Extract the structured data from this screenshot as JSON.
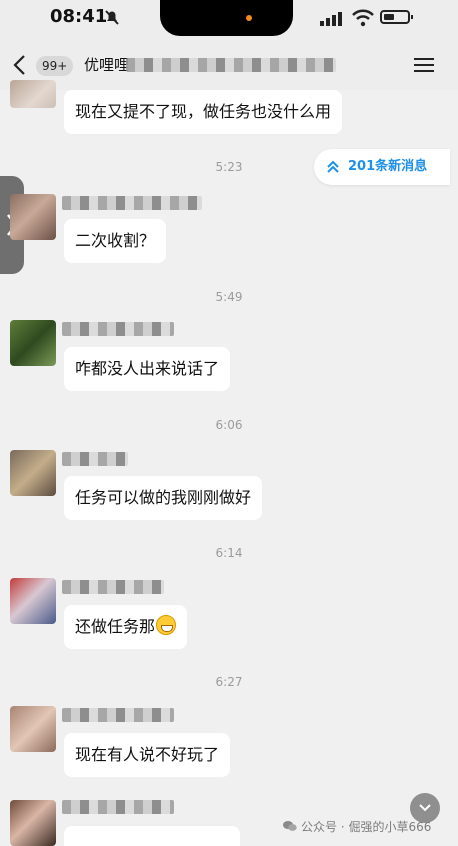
{
  "status_bar": {
    "time": "08:41",
    "icons": [
      "bell-off-icon",
      "signal-icon",
      "wifi-icon",
      "battery-icon"
    ],
    "accent": "#f28b1f"
  },
  "header": {
    "back_icon": "chevron-left-icon",
    "unread_badge": "99+",
    "title": "优哩哩",
    "menu_icon": "menu-icon"
  },
  "new_messages_button": {
    "label": "201条新消息",
    "icon": "double-chevron-up-icon",
    "color": "#1e90e6"
  },
  "messages": [
    {
      "type": "text",
      "text": "现在又提不了现，做任务也没什么用"
    },
    {
      "type": "time",
      "text": "5:23"
    },
    {
      "type": "text",
      "text": "二次收割？"
    },
    {
      "type": "time",
      "text": "5:49"
    },
    {
      "type": "text",
      "text": "咋都没人出来说话了"
    },
    {
      "type": "time",
      "text": "6:06"
    },
    {
      "type": "text",
      "text": "任务可以做的我刚刚做好"
    },
    {
      "type": "time",
      "text": "6:14"
    },
    {
      "type": "text",
      "text": "还做任务那",
      "emoji": "grin-emoji"
    },
    {
      "type": "time",
      "text": "6:27"
    },
    {
      "type": "text",
      "text": "现在有人说不好玩了"
    }
  ],
  "watermark": {
    "label": "公众号 · 倔强的小草666",
    "icon": "wechat-icon"
  },
  "scroll_down_icon": "chevron-down-icon"
}
